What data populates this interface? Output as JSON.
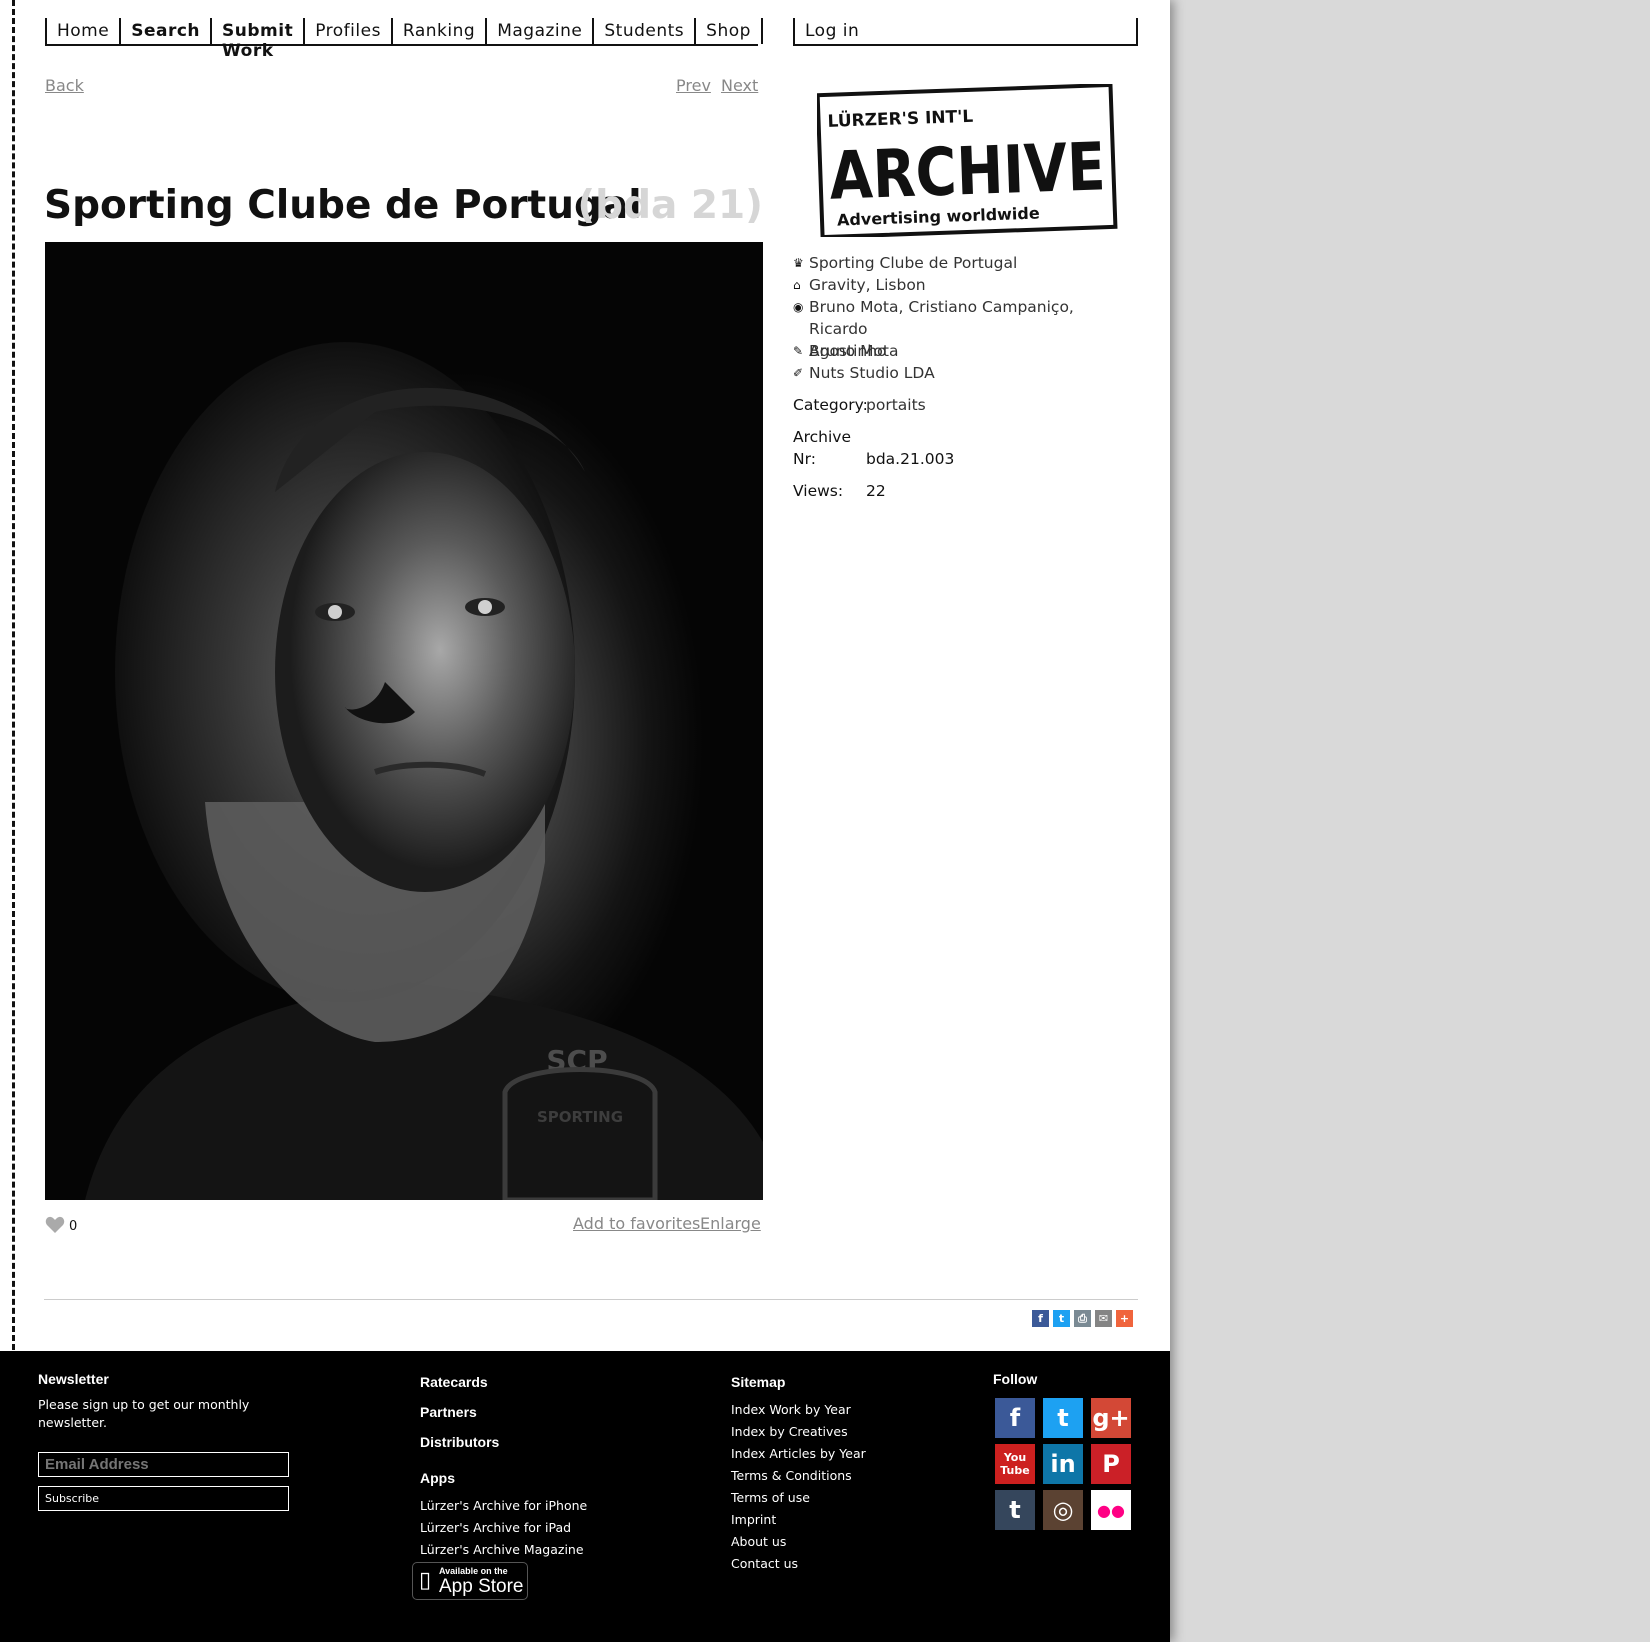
{
  "nav": {
    "items": [
      "Home",
      "Search",
      "Submit Work",
      "Profiles",
      "Ranking",
      "Magazine",
      "Students",
      "Shop"
    ],
    "login": "Log in"
  },
  "pager": {
    "back": "Back",
    "prev": "Prev",
    "next": "Next"
  },
  "work": {
    "title": "Sporting Clube de Portugal",
    "issue": "(bda 21)",
    "likes": "0",
    "add_favorites": "Add to favorites",
    "enlarge": "Enlarge",
    "photo_badge": "SCP",
    "photo_badge_text": "SPORTING"
  },
  "logo": {
    "line1": "LÜRZER'S   INT'L",
    "line2": "ARCHIVE",
    "line3": "Advertising worldwide"
  },
  "details": {
    "client": "Sporting Clube de Portugal",
    "agency": "Gravity, Lisbon",
    "creatives_line1": "Bruno Mota, Cristiano Campaniço, Ricardo",
    "creatives_line2": "Agostinho",
    "photographer": "Bruno Mota",
    "production": "Nuts Studio LDA",
    "category_label": "Category:",
    "category_value": "portaits",
    "archive_label1": "Archive",
    "archive_label2": "Nr:",
    "archive_value": "bda.21.003",
    "views_label": "Views:",
    "views_value": "22"
  },
  "icons": {
    "client": "crown-icon",
    "agency": "house-icon",
    "creatives": "eye-icon",
    "photographer": "pencil-icon",
    "production": "brush-icon"
  },
  "share_icons": [
    "facebook-icon",
    "twitter-icon",
    "print-icon",
    "email-icon",
    "more-icon"
  ],
  "footer": {
    "newsletter_title": "Newsletter",
    "newsletter_text1": "Please sign up to get our monthly",
    "newsletter_text2": "newsletter.",
    "email_placeholder": "Email Address",
    "subscribe": "Subscribe",
    "ratecards": "Ratecards",
    "partners": "Partners",
    "distributors": "Distributors",
    "apps_title": "Apps",
    "apps": [
      "Lürzer's Archive for iPhone",
      "Lürzer's Archive for iPad",
      "Lürzer's Archive Magazine"
    ],
    "appstore_top": "Available on the",
    "appstore_bottom": "App Store",
    "sitemap_title": "Sitemap",
    "sitemap": [
      "Index Work by Year",
      "Index by Creatives",
      "Index Articles by Year",
      "Terms & Conditions",
      "Terms of use",
      "Imprint",
      "About us",
      "Contact us"
    ],
    "follow_title": "Follow",
    "social": [
      {
        "name": "facebook-icon",
        "glyph": "f",
        "color": "#3b5998"
      },
      {
        "name": "twitter-icon",
        "glyph": "t",
        "color": "#1da1f2"
      },
      {
        "name": "google-plus-icon",
        "glyph": "g+",
        "color": "#d34836"
      },
      {
        "name": "youtube-icon",
        "glyph": "You Tube",
        "color": "#cd201f"
      },
      {
        "name": "linkedin-icon",
        "glyph": "in",
        "color": "#0e76a8"
      },
      {
        "name": "pinterest-icon",
        "glyph": "P",
        "color": "#cb2027"
      },
      {
        "name": "tumblr-icon",
        "glyph": "t",
        "color": "#35465c"
      },
      {
        "name": "instagram-icon",
        "glyph": "◎",
        "color": "#5b4232"
      },
      {
        "name": "flickr-icon",
        "glyph": "●●",
        "color": "#ffffff"
      }
    ]
  },
  "colors": {
    "link_gray": "#888888",
    "issue_gray": "#d6d6d6",
    "footer_bg": "#000000",
    "page_bg": "#d9d9d9"
  }
}
